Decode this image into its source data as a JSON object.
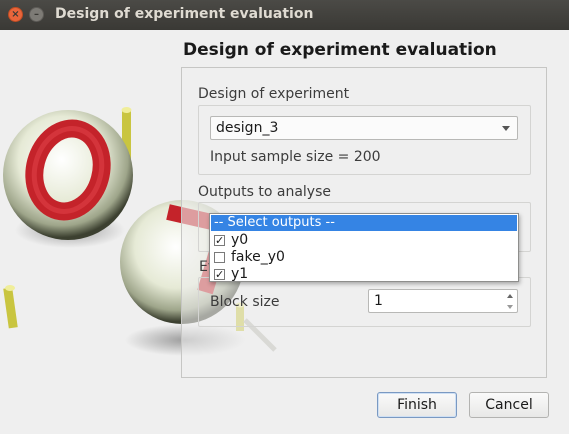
{
  "window": {
    "title": "Design of experiment evaluation",
    "close_glyph": "×",
    "minimize_glyph": "–"
  },
  "page": {
    "title": "Design of experiment evaluation"
  },
  "design_section": {
    "label": "Design of experiment",
    "selected_design": "design_3",
    "sample_size_text": "Input sample size = 200"
  },
  "outputs_section": {
    "label": "Outputs to analyse",
    "dropdown_header": "-- Select outputs --",
    "options": [
      {
        "label": "y0",
        "checked": true
      },
      {
        "label": "fake_y0",
        "checked": false
      },
      {
        "label": "y1",
        "checked": true
      }
    ]
  },
  "evaluation_section": {
    "label_partial": "Ev",
    "block_size_label": "Block size",
    "block_size_value": "1"
  },
  "buttons": {
    "finish": "Finish",
    "cancel": "Cancel"
  },
  "side_art": {
    "balls": [
      "0",
      "7"
    ],
    "colors": {
      "ball": "#e8ecd8",
      "numeral": "#c4232a",
      "pin": "#d8d44a"
    }
  },
  "check_glyph": "✓"
}
